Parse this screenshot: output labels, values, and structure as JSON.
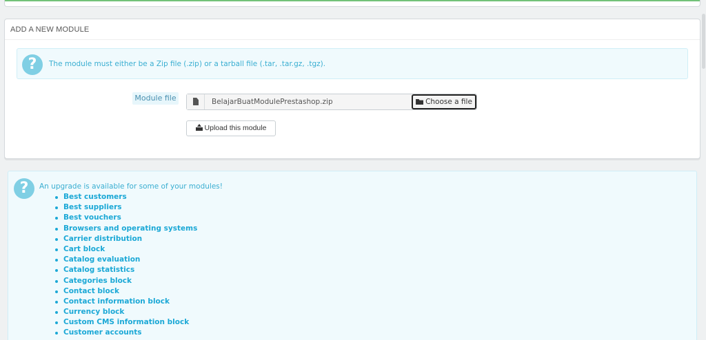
{
  "add_module": {
    "heading": "ADD A NEW MODULE",
    "info_message": "The module must either be a Zip file (.zip) or a tarball file (.tar, .tar.gz, .tgz).",
    "field_label": "Module file",
    "file_name": "BelajarBuatModulePrestashop.zip",
    "choose_label": "Choose a file",
    "upload_label": "Upload this module"
  },
  "upgrade": {
    "message": "An upgrade is available for some of your modules!",
    "modules": [
      "Best customers",
      "Best suppliers",
      "Best vouchers",
      "Browsers and operating systems",
      "Carrier distribution",
      "Cart block",
      "Catalog evaluation",
      "Catalog statistics",
      "Categories block",
      "Contact block",
      "Contact information block",
      "Currency block",
      "Custom CMS information block",
      "Customer accounts"
    ]
  },
  "colors": {
    "accent": "#1ba8d6",
    "info_text": "#39aed1",
    "info_bg": "#f0fafd",
    "success_strip": "#72c279"
  },
  "icons": {
    "info": "question-circle-icon",
    "file": "file-icon",
    "folder": "folder-open-icon",
    "upload": "upload-icon"
  }
}
